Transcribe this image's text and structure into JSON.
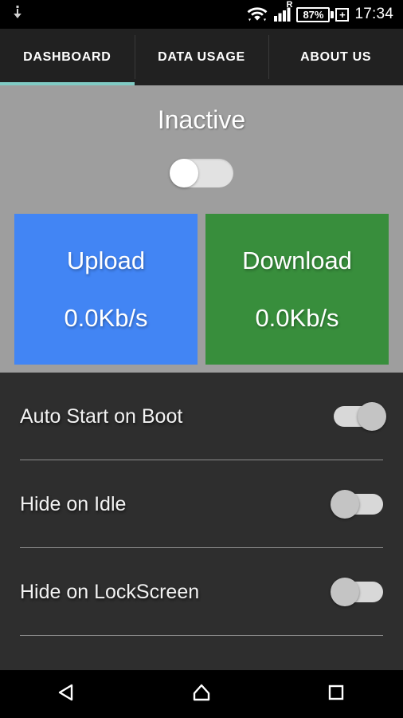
{
  "statusbar": {
    "notification_icon": "download-arrow-icon",
    "wifi_icon": "wifi-icon",
    "roaming_label": "R",
    "signal_icon": "cellular-signal-icon",
    "battery_percent": "87%",
    "battery_charging_icon": "battery-plus-icon",
    "time": "17:34"
  },
  "tabs": [
    {
      "label": "DASHBOARD",
      "active": true
    },
    {
      "label": "DATA USAGE",
      "active": false
    },
    {
      "label": "ABOUT US",
      "active": false
    }
  ],
  "dashboard": {
    "status_title": "Inactive",
    "main_toggle_state": "off",
    "cards": [
      {
        "label": "Upload",
        "value": "0.0Kb/s",
        "color": "#4285f4"
      },
      {
        "label": "Download",
        "value": "0.0Kb/s",
        "color": "#388e3c"
      }
    ]
  },
  "settings": {
    "rows": [
      {
        "label": "Auto Start on Boot",
        "state": "on"
      },
      {
        "label": "Hide on Idle",
        "state": "off"
      },
      {
        "label": "Hide on LockScreen",
        "state": "off"
      }
    ]
  },
  "navbar": {
    "back_icon": "back-triangle-icon",
    "home_icon": "home-icon",
    "recents_icon": "recents-square-icon"
  },
  "colors": {
    "accent": "#80cbc4",
    "panel_gray": "#9e9e9e",
    "settings_bg": "#2e2e2e",
    "upload": "#4285f4",
    "download": "#388e3c"
  }
}
